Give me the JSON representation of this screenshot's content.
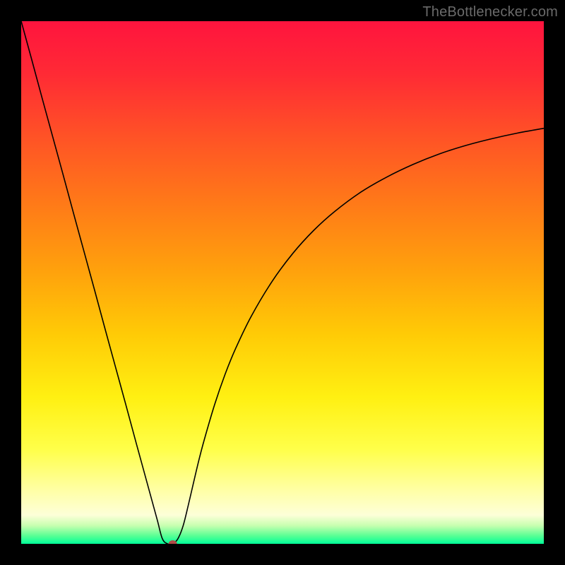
{
  "watermark": "TheBottlenecker.com",
  "chart_data": {
    "type": "line",
    "title": "",
    "xlabel": "",
    "ylabel": "",
    "xlim": [
      0,
      100
    ],
    "ylim": [
      0,
      100
    ],
    "grid": false,
    "legend": false,
    "background_gradient_stops": [
      {
        "offset": 0.0,
        "color": "#ff143e"
      },
      {
        "offset": 0.1,
        "color": "#ff2a35"
      },
      {
        "offset": 0.22,
        "color": "#ff5226"
      },
      {
        "offset": 0.35,
        "color": "#ff7a18"
      },
      {
        "offset": 0.48,
        "color": "#ffa20c"
      },
      {
        "offset": 0.6,
        "color": "#ffcb06"
      },
      {
        "offset": 0.72,
        "color": "#fff012"
      },
      {
        "offset": 0.82,
        "color": "#ffff4a"
      },
      {
        "offset": 0.9,
        "color": "#ffffa8"
      },
      {
        "offset": 0.945,
        "color": "#fdffd8"
      },
      {
        "offset": 0.965,
        "color": "#c8ffb0"
      },
      {
        "offset": 0.985,
        "color": "#57ff94"
      },
      {
        "offset": 1.0,
        "color": "#00ff99"
      }
    ],
    "series": [
      {
        "name": "bottleneck-curve",
        "color": "#000000",
        "stroke_width": 1.6,
        "x": [
          0,
          2,
          4,
          6,
          8,
          10,
          12,
          14,
          16,
          18,
          20,
          22,
          24,
          26,
          27,
          28,
          29,
          30,
          31,
          32,
          33,
          34,
          35,
          37,
          39,
          41,
          44,
          48,
          52,
          56,
          60,
          65,
          70,
          75,
          80,
          85,
          90,
          95,
          100
        ],
        "y": [
          100,
          92.7,
          85.3,
          78.0,
          70.7,
          63.3,
          56.0,
          48.7,
          41.3,
          34.0,
          26.7,
          19.3,
          12.0,
          4.7,
          1.0,
          0.0,
          0.0,
          1.0,
          3.5,
          7.5,
          11.8,
          16.0,
          19.8,
          26.6,
          32.4,
          37.3,
          43.5,
          50.2,
          55.6,
          60.0,
          63.6,
          67.3,
          70.2,
          72.6,
          74.6,
          76.2,
          77.5,
          78.6,
          79.5
        ]
      }
    ],
    "marker": {
      "name": "optimal-point",
      "x": 29.0,
      "y": 0.0,
      "rx": 6,
      "ry": 5,
      "fill": "#b04a46"
    }
  }
}
